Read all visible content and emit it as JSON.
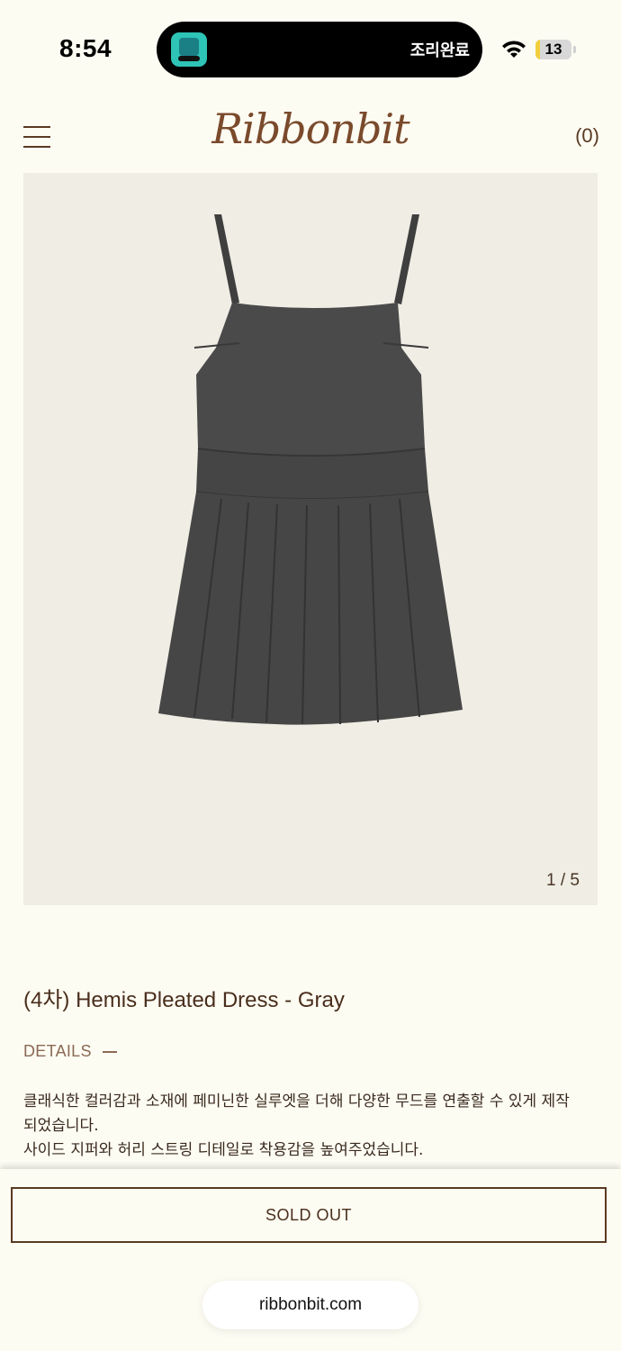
{
  "status_bar": {
    "time": "8:54",
    "island_text": "조리완료",
    "battery_level": "13",
    "battery_fraction": 0.13,
    "icons": [
      "baemin-app-icon",
      "wifi-icon",
      "battery-icon"
    ]
  },
  "header": {
    "logo": "Ribbonbit",
    "cart_count": "(0)",
    "menu_icon": "hamburger-menu-icon"
  },
  "product": {
    "image_counter": "1 / 5",
    "title": "(4차) Hemis Pleated Dress - Gray",
    "details_label": "DETAILS",
    "description_lines": [
      "클래식한 컬러감과 소재에 페미닌한 실루엣을 더해 다양한 무드를 연출할 수 있게 제작",
      "되었습니다.",
      "사이드 지퍼와 허리 스트링 디테일로 착용감을 높여주었습니다."
    ]
  },
  "bottom": {
    "button_label": "SOLD OUT",
    "url": "ribbonbit.com"
  },
  "colors": {
    "background": "#fdfcf3",
    "brand_brown": "#7a4a2c",
    "image_bg": "#efede4",
    "dress_gray": "#4a4a4a"
  }
}
